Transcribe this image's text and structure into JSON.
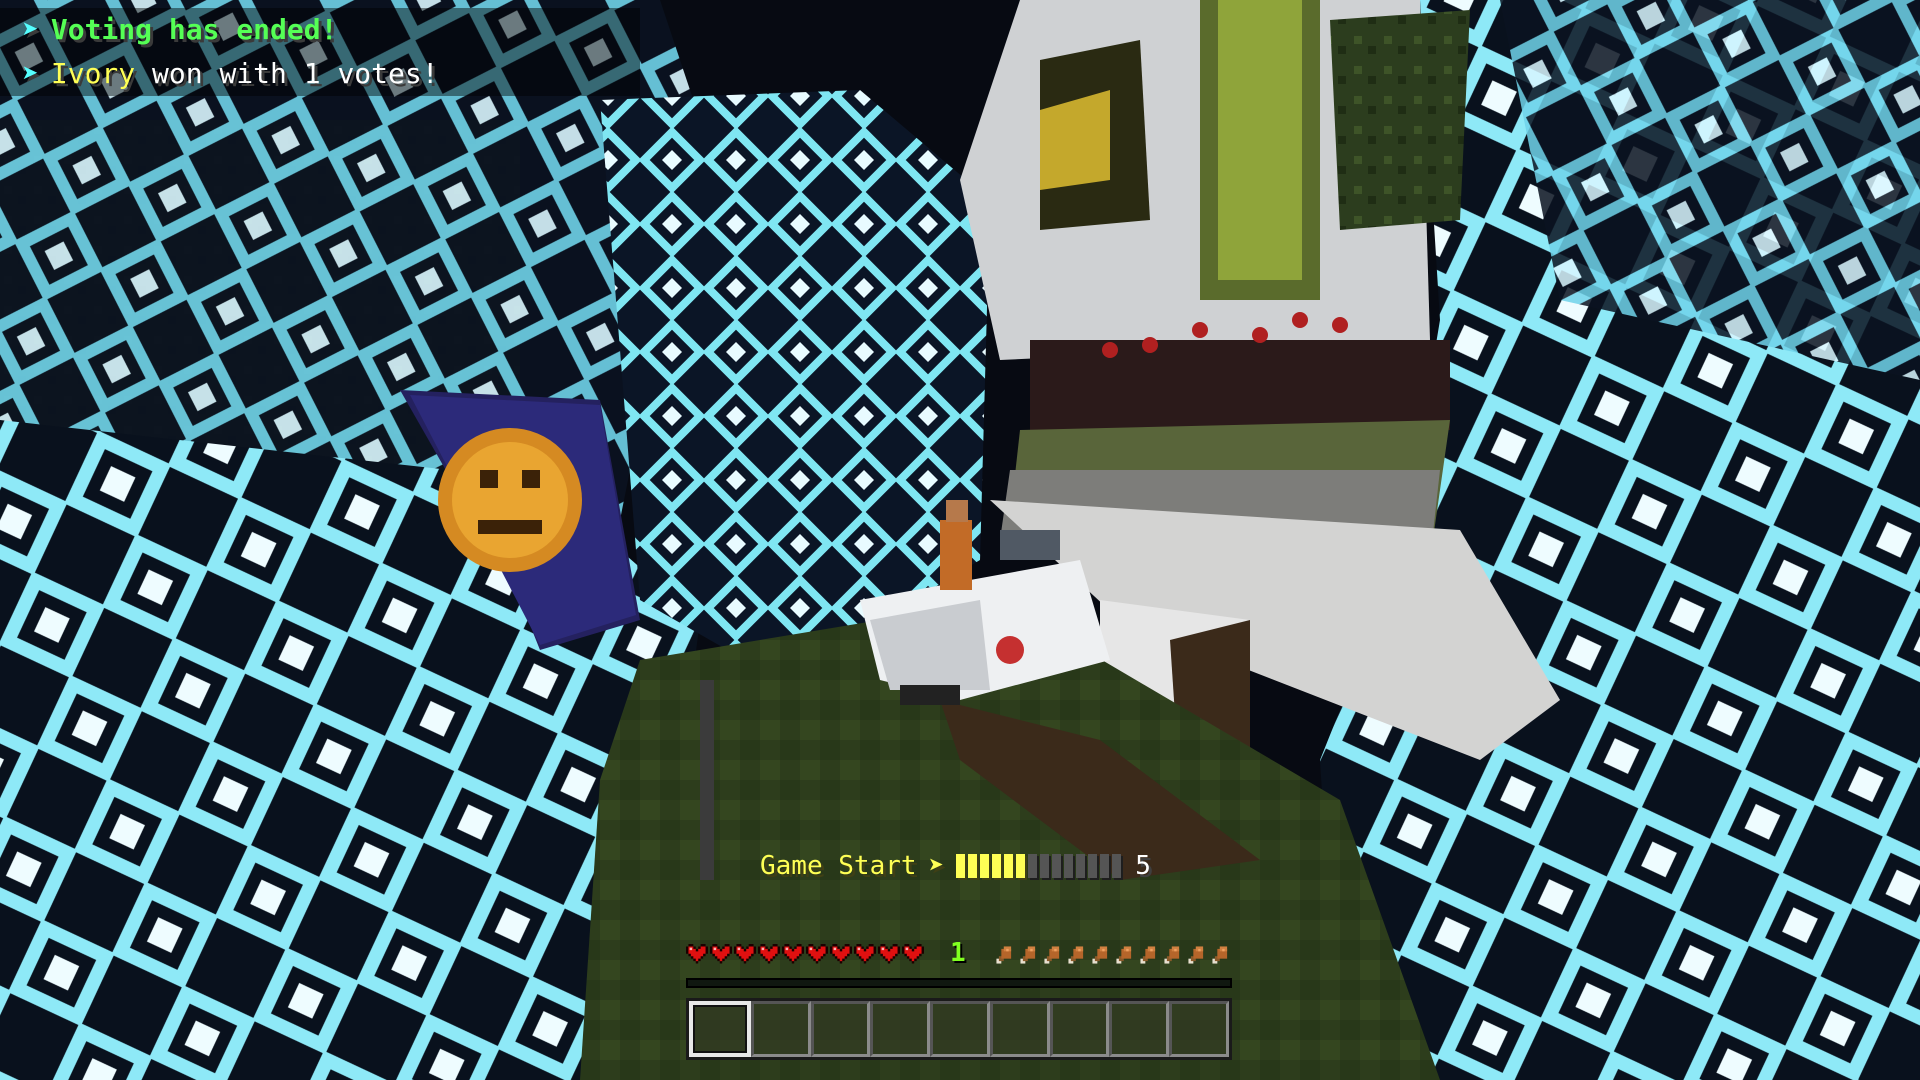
{
  "chat": {
    "line1": {
      "arrow": "➤",
      "text": "Voting has ended!"
    },
    "line2": {
      "arrow": "➤",
      "name": "Ivory",
      "rest": " won with 1 votes!"
    }
  },
  "countdown": {
    "label": "Game Start",
    "arrow": "➤",
    "progress_filled": 6,
    "progress_total": 14,
    "seconds": "5"
  },
  "hud": {
    "hearts": 10,
    "level": "1",
    "food": 10,
    "hotbar_slots": 9,
    "selected_slot": 1
  },
  "colors": {
    "chat_green": "#55ff55",
    "chat_yellow": "#ffff55",
    "chat_arrow": "#55ffff",
    "xp_green": "#80ff20",
    "pattern_light": "#7fe6f2",
    "pattern_dark": "#0b1526"
  }
}
